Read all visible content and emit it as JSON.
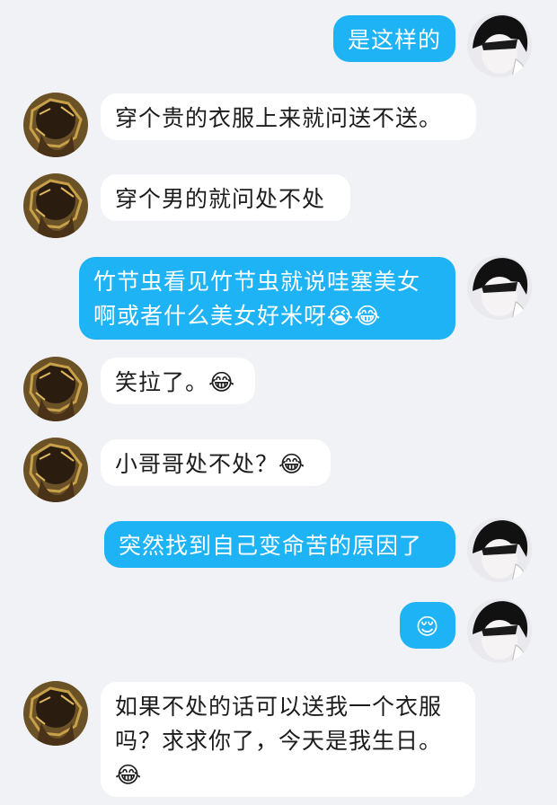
{
  "messages": [
    {
      "side": "out",
      "text": "是这样的"
    },
    {
      "side": "in",
      "text": "穿个贵的衣服上来就问送不送。"
    },
    {
      "side": "in",
      "text": "穿个男的就问处不处"
    },
    {
      "side": "out",
      "text": "竹节虫看见竹节虫就说哇塞美女\n啊或者什么美女好米呀😭😂"
    },
    {
      "side": "in",
      "text": "笑拉了。😂"
    },
    {
      "side": "in",
      "text": "小哥哥处不处？😂"
    },
    {
      "side": "out",
      "text": "突然找到自己变命苦的原因了"
    },
    {
      "side": "out",
      "text": "😌"
    },
    {
      "side": "in",
      "text": "如果不处的话可以送我一个衣服\n吗？求求你了，今天是我生日。\n😂"
    }
  ],
  "colors": {
    "background": "#f1f2f6",
    "outgoing_bubble": "#1eb3f5",
    "incoming_bubble": "#ffffff"
  },
  "icons": {
    "incoming_avatar": "dark-figure-avatar-icon",
    "outgoing_avatar": "pale-face-avatar-icon"
  }
}
